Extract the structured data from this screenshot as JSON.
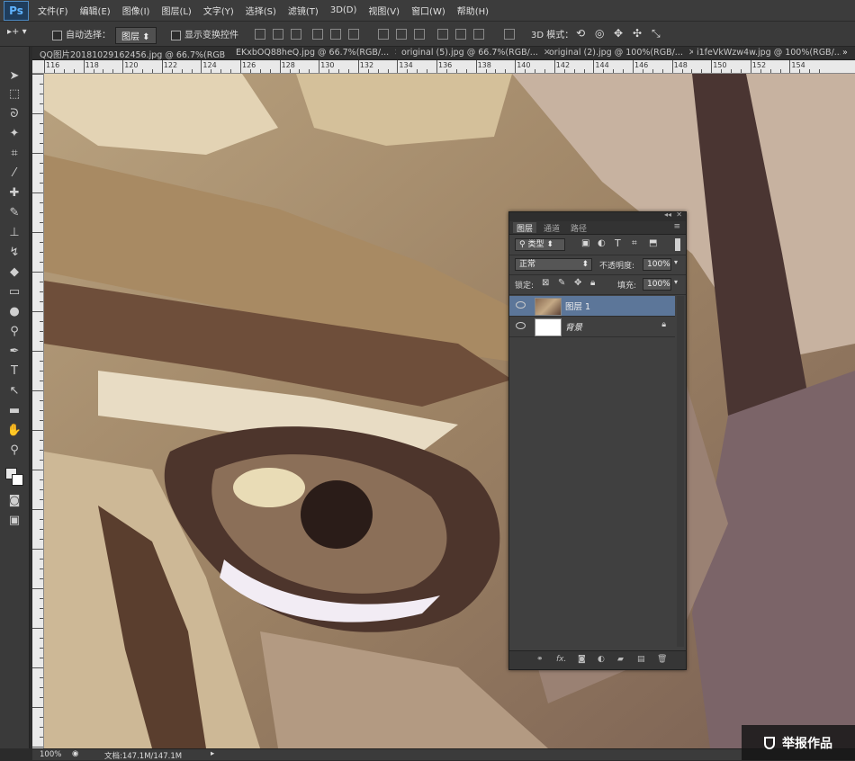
{
  "app": {
    "logo": "Ps"
  },
  "menu": [
    "文件(F)",
    "编辑(E)",
    "图像(I)",
    "图层(L)",
    "文字(Y)",
    "选择(S)",
    "滤镜(T)",
    "3D(D)",
    "视图(V)",
    "窗口(W)",
    "帮助(H)"
  ],
  "options": {
    "auto_select_label": "自动选择：",
    "auto_select_value": "图层",
    "show_transform_label": "显示变换控件",
    "mode_3d_label": "3D 模式："
  },
  "tabs": [
    "QQ图片20181029162456.jpg @ 66.7%(RGB/...",
    "EKxbOQ88heQ.jpg @ 66.7%(RGB/...",
    "original (5).jpg @ 66.7%(RGB/...",
    "original (2).jpg @ 100%(RGB/...",
    "i1feVkWzw4w.jpg @ 100%(RGB/..."
  ],
  "ruler": {
    "labels": [
      "116",
      "118",
      "120",
      "122",
      "124",
      "126",
      "128",
      "130",
      "132",
      "134",
      "136",
      "138",
      "140",
      "142",
      "144",
      "146",
      "148",
      "150",
      "152",
      "154"
    ]
  },
  "layers_panel": {
    "tabs": [
      "图层",
      "通道",
      "路径"
    ],
    "filter_kind": "类型",
    "blend_mode": "正常",
    "opacity_label": "不透明度:",
    "opacity_value": "100%",
    "lock_label": "锁定:",
    "fill_label": "填充:",
    "fill_value": "100%",
    "layers": [
      {
        "name": "图层 1",
        "selected": true
      },
      {
        "name": "背景",
        "selected": false
      }
    ],
    "footer_fx": "fx."
  },
  "status": {
    "zoom": "100%",
    "doc_info": "文档:147.1M/147.1M"
  },
  "watermark": "举报作品",
  "colors": {
    "selected_layer": "#5c7699",
    "panel_bg": "#404040",
    "ui_bg": "#3a3a3a"
  }
}
